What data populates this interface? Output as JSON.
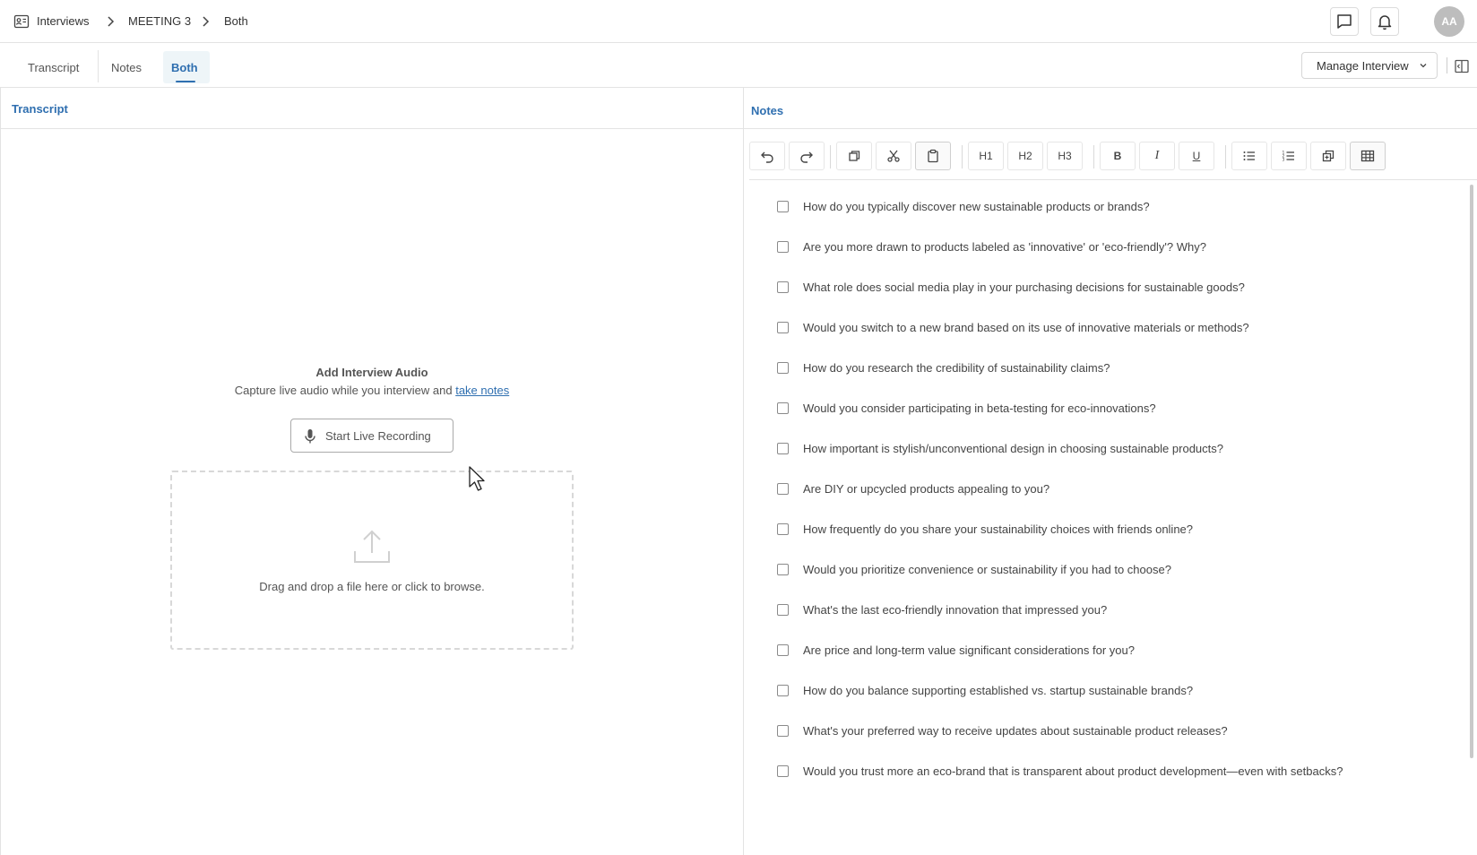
{
  "breadcrumb": {
    "items": [
      "Interviews",
      "MEETING 3",
      "Both"
    ]
  },
  "header": {
    "avatar_initials": "AA"
  },
  "tabs": {
    "items": [
      "Transcript",
      "Notes",
      "Both"
    ],
    "active": "Both",
    "manage_label": "Manage Interview"
  },
  "transcript": {
    "title": "Transcript",
    "audio_title": "Add Interview Audio",
    "audio_subtitle": "Capture live audio while you interview and",
    "audio_link": "take notes",
    "record_label": "Start Live Recording",
    "drop_text": "Drag and drop a file here or click to browse."
  },
  "notes": {
    "title": "Notes",
    "toolbar": {
      "h1": "H1",
      "h2": "H2",
      "h3": "H3",
      "bold": "B",
      "italic": "I",
      "underline": "U"
    },
    "questions": [
      "How do you typically discover new sustainable products or brands?",
      "Are you more drawn to products labeled as 'innovative' or 'eco-friendly'? Why?",
      "What role does social media play in your purchasing decisions for sustainable goods?",
      "Would you switch to a new brand based on its use of innovative materials or methods?",
      "How do you research the credibility of sustainability claims?",
      "Would you consider participating in beta-testing for eco-innovations?",
      "How important is stylish/unconventional design in choosing sustainable products?",
      "Are DIY or upcycled products appealing to you?",
      "How frequently do you share your sustainability choices with friends online?",
      "Would you prioritize convenience or sustainability if you had to choose?",
      "What's the last eco-friendly innovation that impressed you?",
      "Are price and long-term value significant considerations for you?",
      "How do you balance supporting established vs. startup sustainable brands?",
      "What's your preferred way to receive updates about sustainable product releases?",
      "Would you trust more an eco-brand that is transparent about product development—even with setbacks?"
    ]
  },
  "colors": {
    "accent": "#2f6fb0",
    "avatar_bg": "#bdbdbd",
    "active_tab_bg": "#eef5f8"
  }
}
